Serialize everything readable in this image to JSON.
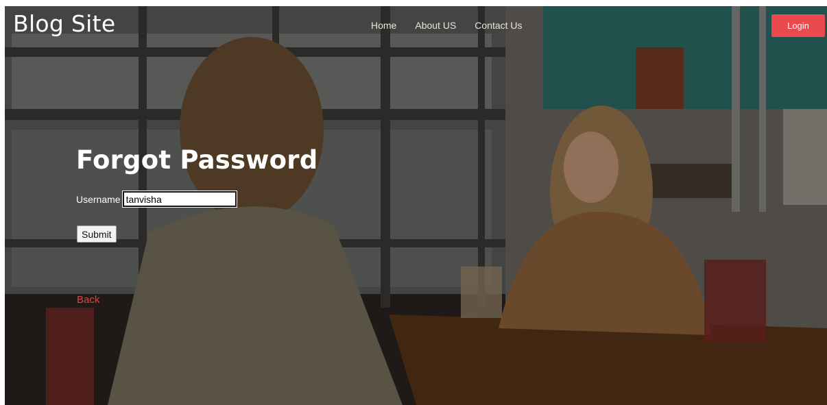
{
  "header": {
    "brand": "Blog Site",
    "nav": [
      {
        "label": "Home"
      },
      {
        "label": "About US"
      },
      {
        "label": "Contact Us"
      }
    ],
    "login_label": "Login"
  },
  "form": {
    "title": "Forgot Password",
    "username_label": "Username",
    "username_value": "tanvisha",
    "submit_label": "Submit",
    "back_label": "Back"
  },
  "colors": {
    "accent": "#e84a4f",
    "back_link": "#e0403f"
  }
}
